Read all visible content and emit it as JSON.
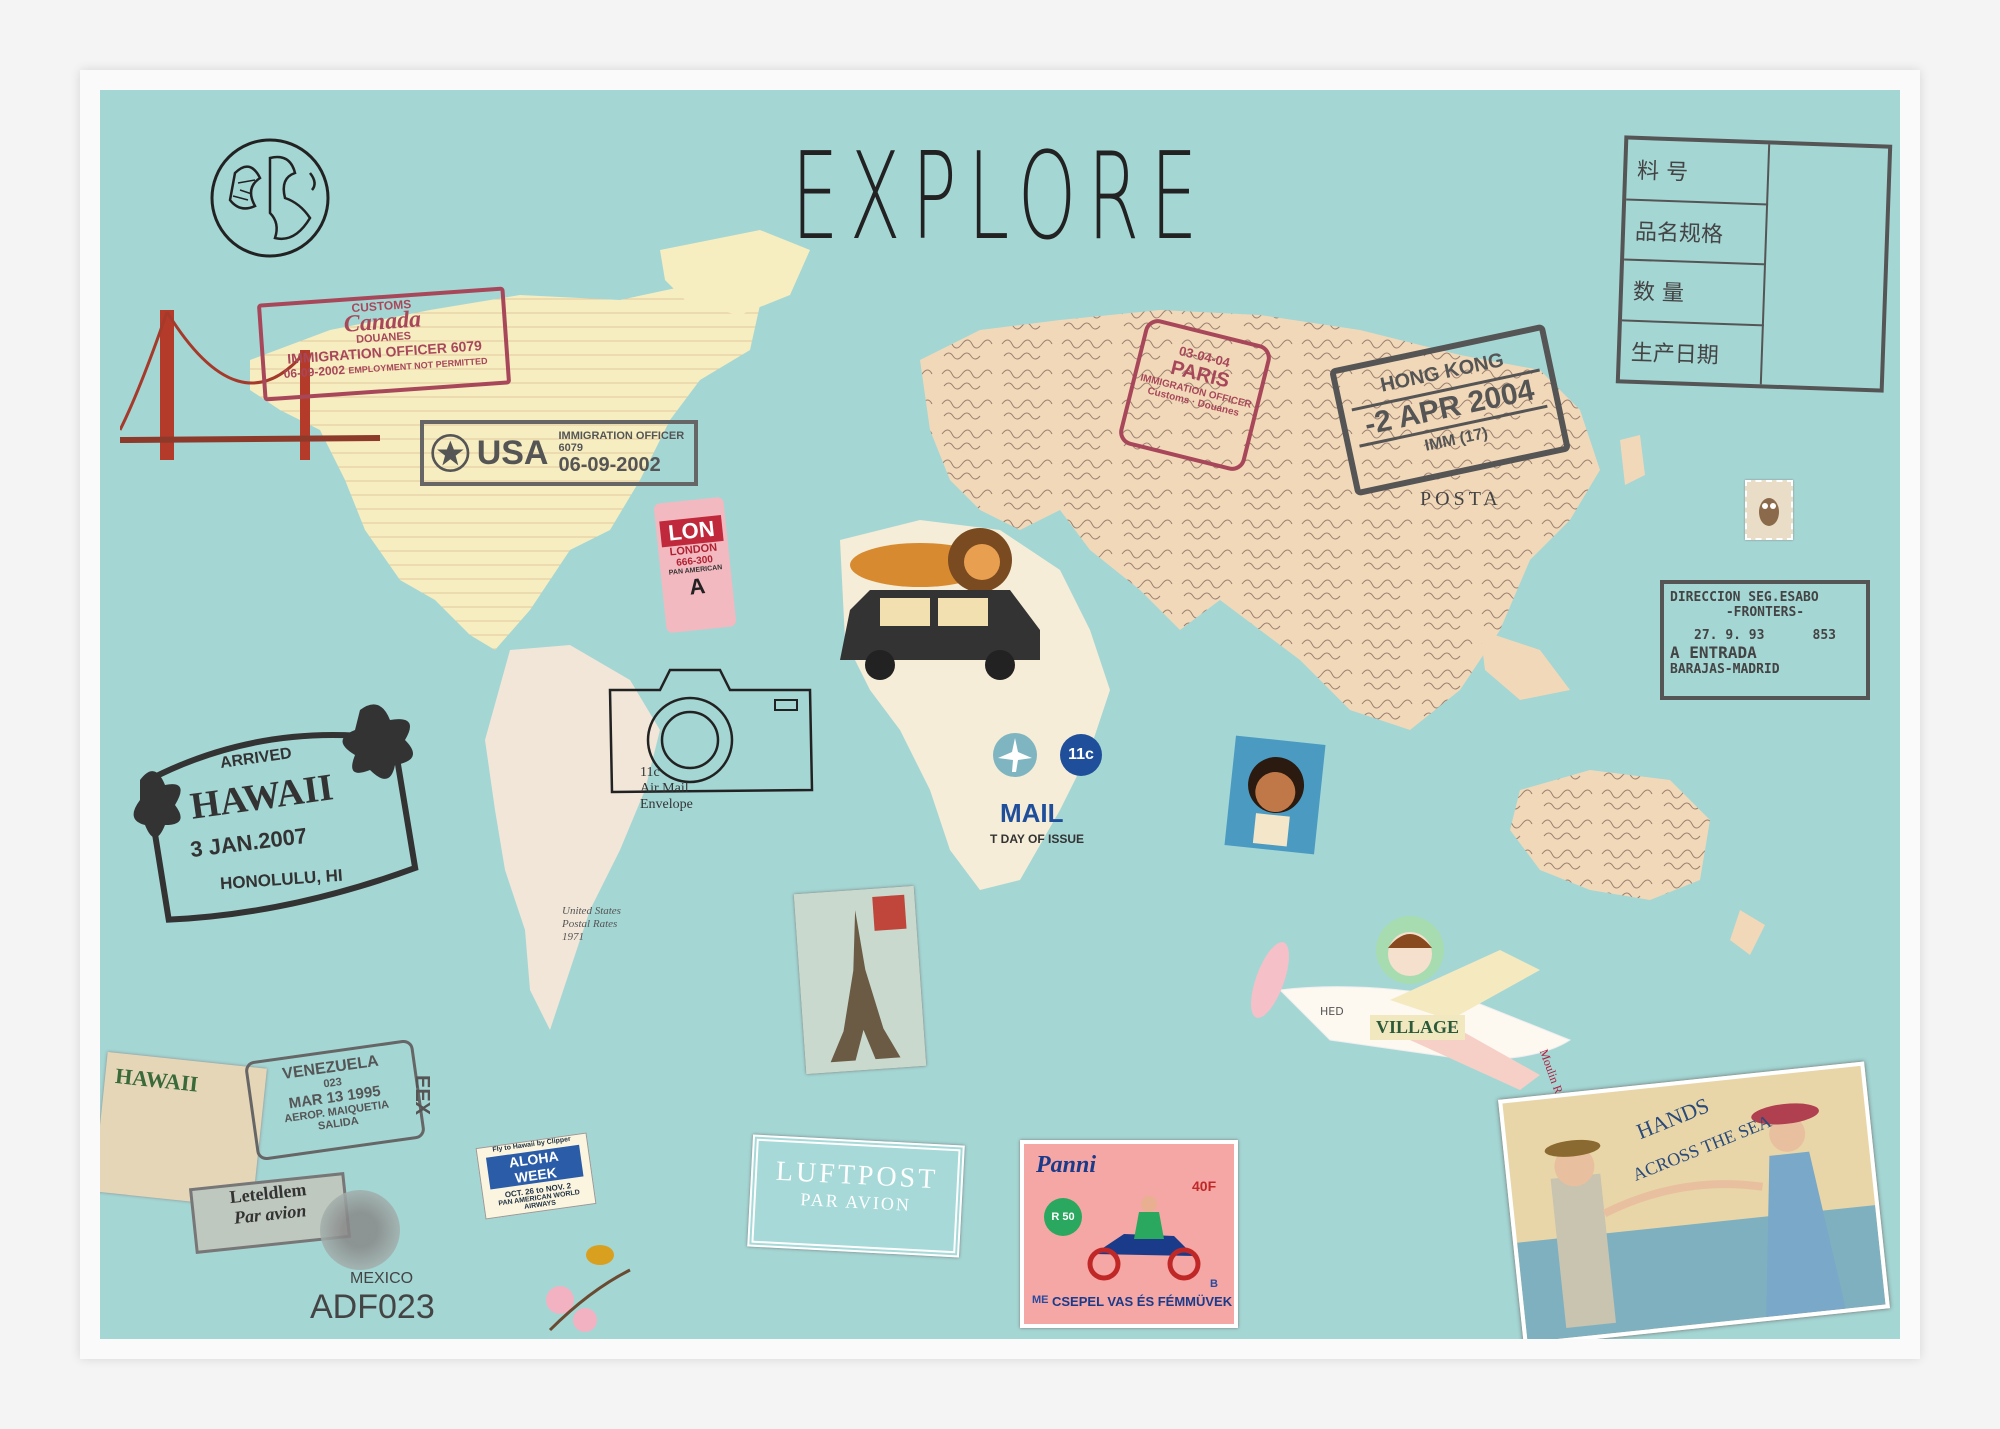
{
  "title": "EXPLORE",
  "colors": {
    "sea": "#a4d6d4",
    "land": "#f3dcb8",
    "land_light": "#f6efb8",
    "stamp_red": "#a8475a",
    "stamp_gray": "#555555",
    "ink": "#222222"
  },
  "stamps": {
    "canada": {
      "line1": "CUSTOMS",
      "line2": "Canada",
      "line3": "DOUANES",
      "line4": "IMMIGRATION OFFICER 6079",
      "line5": "06-09-2002",
      "line6": "EMPLOYMENT NOT PERMITTED"
    },
    "usa": {
      "country": "USA",
      "officer": "IMMIGRATION OFFICER 6079",
      "date": "06-09-2002"
    },
    "paris": {
      "date": "03-04-04",
      "city": "PARIS",
      "officer": "IMMIGRATION OFFICER",
      "footer": "Customs · Douanes"
    },
    "hongkong": {
      "city": "HONG KONG",
      "date": "-2 APR 2004",
      "code": "IMM (17)"
    },
    "china": {
      "r1": "料    号",
      "r2": "品名规格",
      "r3": "数    量",
      "r4": "生产日期"
    },
    "madrid": {
      "line1": "DIRECCION SEG.ESABO",
      "line2": "-FRONTERS-",
      "line3": "27. 9. 93",
      "line4": "853",
      "line5": "A",
      "line6": "ENTRADA",
      "line7": "BARAJAS-MADRID"
    },
    "hawaii": {
      "arrived": "ARRIVED",
      "name": "HAWAII",
      "date": "3  JAN.2007",
      "city": "HONOLULU, HI"
    },
    "venezuela": {
      "line1": "VENEZUELA",
      "line2": "023",
      "line3": "MAR 13 1995",
      "line4": "AEROP. MAIQUETIA",
      "line5": "SALIDA",
      "side": "EEX"
    },
    "luftpost": {
      "line1": "LUFTPOST",
      "line2": "PAR AVION"
    },
    "leteldlem": {
      "line1": "Leteldlem",
      "line2": "Par avion"
    },
    "mexico": {
      "label": "MEXICO",
      "code": "ADF023"
    }
  },
  "tags": {
    "london": {
      "code": "LON",
      "city": "LONDON",
      "num": "666-300",
      "airline": "PAN AMERICAN",
      "letter": "A"
    },
    "airmail": {
      "line1": "11c",
      "line2": "Air Mail",
      "line3": "Envelope"
    },
    "africa_mail": {
      "value": "11c",
      "mail": "MAIL",
      "issue": "T DAY OF ISSUE"
    },
    "us_stamp": {
      "line1": "United States",
      "line2": "Postal Rates",
      "line3": "1971"
    },
    "postal": {
      "post": "POSTA"
    },
    "hawaii_card": {
      "title": "HAWAII"
    },
    "aloha": {
      "top": "Fly to Hawaii by Clipper",
      "main": "ALOHA WEEK",
      "dates": "OCT. 26 to NOV. 2",
      "footer": "PAN AMERICAN WORLD AIRWAYS"
    },
    "panni": {
      "brand": "Panni",
      "price": "40F",
      "plate": "R 50",
      "footer": "CSEPEL VAS ÉS FÉMMÜVEK",
      "corner": "B",
      "logo": "ME"
    },
    "village": {
      "label": "VILLAGE",
      "wing": "Moulin Rouge",
      "wing2": "HED"
    },
    "hands": {
      "line1": "HANDS",
      "line2": "ACROSS THE SEA"
    }
  }
}
